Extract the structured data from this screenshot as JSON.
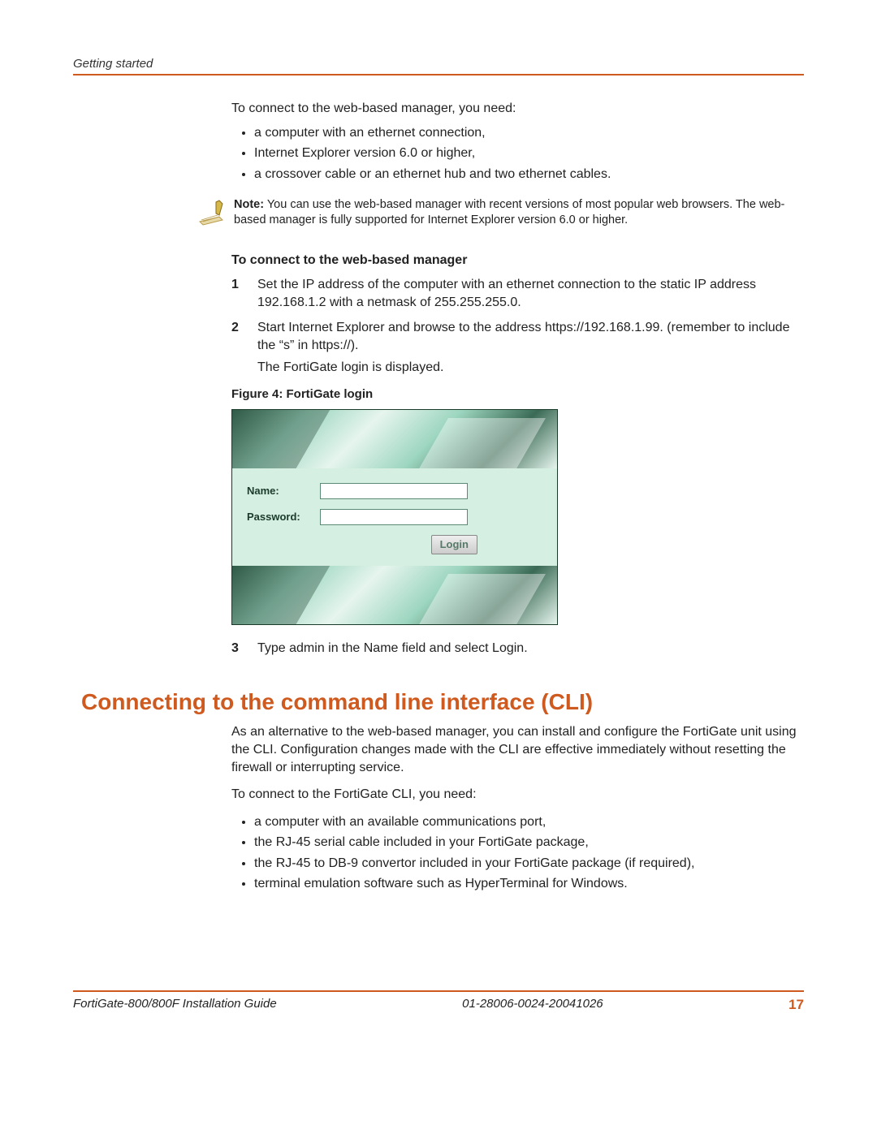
{
  "header": {
    "section": "Getting started"
  },
  "intro": {
    "line": "To connect to the web-based manager, you need:",
    "bullets": [
      "a computer with an ethernet connection,",
      "Internet Explorer version 6.0 or higher,",
      "a crossover cable or an ethernet hub and two ethernet cables."
    ]
  },
  "note": {
    "label": "Note:",
    "text": " You can use the web-based manager with recent versions of most popular web browsers. The web-based manager is fully supported for Internet Explorer version 6.0 or higher."
  },
  "procedure": {
    "heading": "To connect to the web-based manager",
    "steps": [
      {
        "n": "1",
        "text": "Set the IP address of the computer with an ethernet connection to the static IP address 192.168.1.2 with a netmask of 255.255.255.0."
      },
      {
        "n": "2",
        "text": "Start Internet Explorer and browse to the address https://192.168.1.99. (remember to include the “s” in https://).",
        "cont": "The FortiGate login is displayed."
      },
      {
        "n": "3",
        "text": "Type admin in the Name field and select Login."
      }
    ],
    "figure": {
      "caption": "Figure 4:   FortiGate login",
      "name_label": "Name:",
      "password_label": "Password:",
      "login_button": "Login"
    }
  },
  "section2": {
    "title": "Connecting to the command line interface (CLI)",
    "para1": "As an alternative to the web-based manager, you can install and configure the FortiGate unit using the CLI. Configuration changes made with the CLI are effective immediately without resetting the firewall or interrupting service.",
    "need_line": "To connect to the FortiGate CLI, you need:",
    "bullets": [
      "a computer with an available communications port,",
      "the RJ-45 serial cable included in your FortiGate package,",
      "the RJ-45 to DB-9 convertor included in your FortiGate package (if required),",
      "terminal emulation software such as HyperTerminal for Windows."
    ]
  },
  "footer": {
    "left": "FortiGate-800/800F Installation Guide",
    "center": "01-28006-0024-20041026",
    "page": "17"
  }
}
